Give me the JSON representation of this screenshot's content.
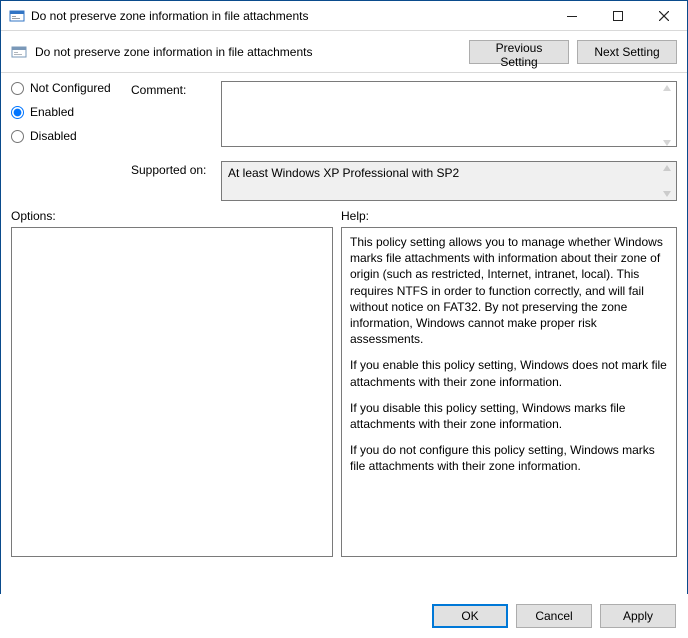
{
  "titlebar": {
    "title": "Do not preserve zone information in file attachments"
  },
  "toolbar": {
    "subtitle": "Do not preserve zone information in file attachments",
    "prev_label": "Previous Setting",
    "next_label": "Next Setting"
  },
  "state": {
    "not_configured_label": "Not Configured",
    "enabled_label": "Enabled",
    "disabled_label": "Disabled",
    "selected": "enabled"
  },
  "labels": {
    "comment": "Comment:",
    "supported_on": "Supported on:",
    "options": "Options:",
    "help": "Help:"
  },
  "fields": {
    "comment": "",
    "supported_on": "At least Windows XP Professional with SP2"
  },
  "help": {
    "p1": "This policy setting allows you to manage whether Windows marks file attachments with information about their zone of origin (such as restricted, Internet, intranet, local). This requires NTFS in order to function correctly, and will fail without notice on FAT32. By not preserving the zone information, Windows cannot make proper risk assessments.",
    "p2": "If you enable this policy setting, Windows does not mark file attachments with their zone information.",
    "p3": "If you disable this policy setting, Windows marks file attachments with their zone information.",
    "p4": "If you do not configure this policy setting, Windows marks file attachments with their zone information."
  },
  "footer": {
    "ok": "OK",
    "cancel": "Cancel",
    "apply": "Apply"
  }
}
